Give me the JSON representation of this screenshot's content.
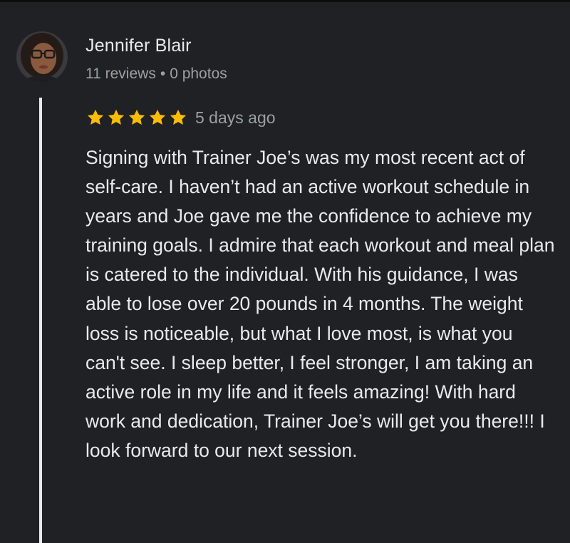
{
  "reviewer": {
    "name": "Jennifer Blair",
    "reviews_count": "11 reviews",
    "separator": "•",
    "photos_count": "0 photos",
    "avatar": "avatar-photo"
  },
  "rating": {
    "stars": 5,
    "max": 5,
    "star_color": "#fbbc04",
    "date": "5 days ago"
  },
  "review_text": "Signing with Trainer Joe’s was my most recent act of self-care. I haven’t had an active workout schedule in years and Joe gave me the confidence to achieve my training goals. I admire that each workout and meal plan is catered to the individual. With his guidance, I was able to lose over 20 pounds in 4 months. The weight loss is noticeable, but what I love most, is what you can't see. I sleep better, I feel stronger, I am taking an active role in my life and it feels amazing! With hard work and dedication, Trainer Joe’s will get you there!!! I look forward to our next session.",
  "colors": {
    "background": "#202124",
    "text_primary": "#e8eaed",
    "text_secondary": "#9aa0a6"
  }
}
